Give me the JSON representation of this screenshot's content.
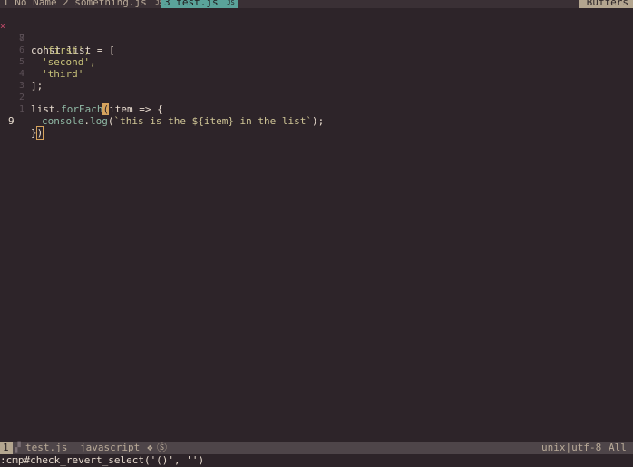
{
  "tabline": {
    "tabs": [
      {
        "num": "1",
        "label": "No Name",
        "icon": ""
      },
      {
        "num": "2",
        "label": "something.js",
        "icon": "JS"
      },
      {
        "num": "3",
        "label": "test.js",
        "icon": "JS"
      }
    ],
    "buffers_label": "Buffers"
  },
  "editor": {
    "lines": [
      {
        "sign": "×",
        "lnum": "8",
        "tokens": [
          "const list = ["
        ]
      },
      {
        "sign": "",
        "lnum": "7",
        "tokens": [
          "  'first',"
        ]
      },
      {
        "sign": "",
        "lnum": "6",
        "tokens": [
          "  'second',"
        ]
      },
      {
        "sign": "",
        "lnum": "5",
        "tokens": [
          "  'third'"
        ]
      },
      {
        "sign": "",
        "lnum": "4",
        "tokens": [
          "];"
        ]
      },
      {
        "sign": "",
        "lnum": "3",
        "tokens": [
          ""
        ]
      },
      {
        "sign": "",
        "lnum": "2",
        "tokens": [
          "list.forEach(item => {"
        ]
      },
      {
        "sign": "",
        "lnum": "1",
        "tokens": [
          "  console.log(`this is the ${item} in the list`);"
        ]
      },
      {
        "sign": "",
        "lnum": "9",
        "tokens": [
          "})"
        ]
      }
    ],
    "line_8_code": "const list = [",
    "line_7_code": "'first',",
    "line_6_code": "'second',",
    "line_5_code": "'third'",
    "line_4_code": "];",
    "line_2_pre": "list",
    "line_2_method": "forEach",
    "line_2_cursor": "(",
    "line_2_post": "item => {",
    "line_1_obj": "console",
    "line_1_method": "log",
    "line_1_open": "(",
    "line_1_template": "`this is the ${item} in the list`",
    "line_1_close": ");",
    "line_9_brace": "}",
    "line_9_paren": ")"
  },
  "statusline": {
    "mode": "1",
    "branch_icon": "",
    "filename": "test.js",
    "filetype": "javascript",
    "indicator_1": "❖",
    "indicator_2": "Ⓢ",
    "encoding": "unix|utf-8",
    "position": "All"
  },
  "cmdline": {
    "text": ":cmp#check_revert_select('()', '')"
  },
  "colors": {
    "background": "#2d2429",
    "active_tab": "#5aa39a",
    "buffers_badge": "#b3a58f",
    "statusline": "#4e4549",
    "cursor": "#d6a35d",
    "sign": "#c24a6a"
  }
}
